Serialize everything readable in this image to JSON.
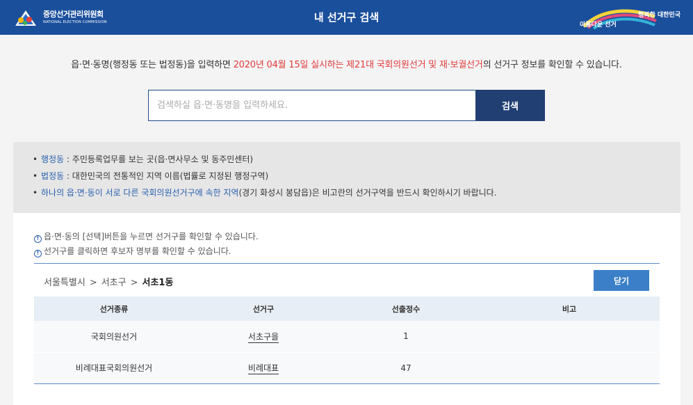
{
  "header": {
    "logo_kr": "중앙선거관리위원회",
    "logo_en": "NATIONAL ELECTION COMMISSION",
    "title": "내 선거구 검색",
    "brand_top": "행복한 대한민국",
    "brand_bottom": "아름다운 선거"
  },
  "intro": {
    "before": "읍·면·동명(행정동 또는 법정동)을 입력하면 ",
    "highlight": "2020년 04월 15일 실시하는 제21대 국회의원선거 및 재·보궐선거",
    "after": "의 선거구 정보를 확인할 수 있습니다."
  },
  "search": {
    "placeholder": "검색하실 읍·면·동명을 입력하세요.",
    "button": "검색"
  },
  "info": [
    {
      "term": "행정동",
      "text": " : 주민등록업무를 보는 곳(읍·면사무소 및 동주민센터)"
    },
    {
      "term": "법정동",
      "text": " : 대한민국의 전통적인 지역 이름(법률로 지정된 행정구역)"
    },
    {
      "term": "하나의 읍·면·동이 서로 다른 국회의원선거구에 속한 지역",
      "text": "(경기 화성시 봉담읍)은 비고란의 선거구역을 반드시 확인하시기 바랍니다."
    }
  ],
  "notes": [
    "읍·면·동의 [선택]버튼을 누르면 선거구를 확인할 수 있습니다.",
    "선거구를 클릭하면 후보자 명부를 확인할 수 있습니다."
  ],
  "breadcrumb": {
    "level1": "서울특별시",
    "level2": "서초구",
    "level3": "서초1동",
    "sep": ">"
  },
  "close_button": "닫기",
  "table": {
    "headers": [
      "선거종류",
      "선거구",
      "선출정수",
      "비고"
    ],
    "rows": [
      {
        "type": "국회의원선거",
        "district": "서초구을",
        "seats": "1",
        "note": ""
      },
      {
        "type": "비례대표국회의원선거",
        "district": "비례대표",
        "seats": "47",
        "note": ""
      }
    ]
  },
  "colors": {
    "header_bg": "#1a4f9c",
    "highlight": "#e03a3a",
    "search_button": "#213f73",
    "close_button": "#3a7fc7"
  }
}
